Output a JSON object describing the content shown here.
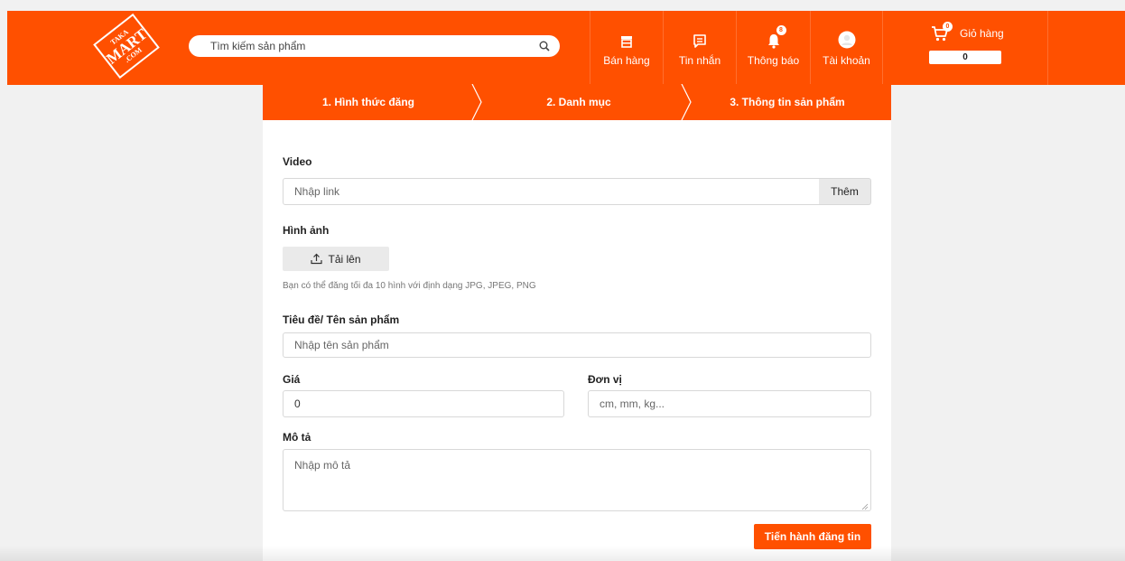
{
  "colors": {
    "brand": "#ff5000",
    "page_bg": "#f1f1f1"
  },
  "logo": {
    "line1": "TAKA",
    "line2": "MART",
    "line3": ".COM"
  },
  "search": {
    "placeholder": "Tìm kiếm sản phẩm",
    "icon": "search-icon"
  },
  "nav": {
    "sell": {
      "label": "Bán hàng",
      "icon": "store-icon"
    },
    "messages": {
      "label": "Tin nhắn",
      "icon": "message-icon"
    },
    "notifications": {
      "label": "Thông báo",
      "icon": "bell-icon",
      "badge": "8"
    },
    "account": {
      "label": "Tài khoản",
      "icon": "avatar-icon"
    }
  },
  "cart": {
    "label": "Giỏ hàng",
    "badge": "0",
    "count": "0",
    "icon": "cart-icon"
  },
  "steps": [
    {
      "label": "1. Hình thức đăng"
    },
    {
      "label": "2. Danh mục"
    },
    {
      "label": "3. Thông tin sản phẩm"
    }
  ],
  "form": {
    "video": {
      "label": "Video",
      "placeholder": "Nhập link",
      "add_label": "Thêm"
    },
    "images": {
      "label": "Hình ảnh",
      "upload_label": "Tải lên",
      "hint": "Bạn có thể đăng tối đa 10 hình với định dạng JPG, JPEG, PNG"
    },
    "title": {
      "label": "Tiêu đề/ Tên sản phẩm",
      "placeholder": "Nhập tên sản phẩm"
    },
    "price": {
      "label": "Giá",
      "value": "0"
    },
    "unit": {
      "label": "Đơn vị",
      "placeholder": "cm, mm, kg..."
    },
    "description": {
      "label": "Mô tả",
      "placeholder": "Nhập mô tả"
    },
    "submit_label": "Tiến hành đăng tin"
  }
}
